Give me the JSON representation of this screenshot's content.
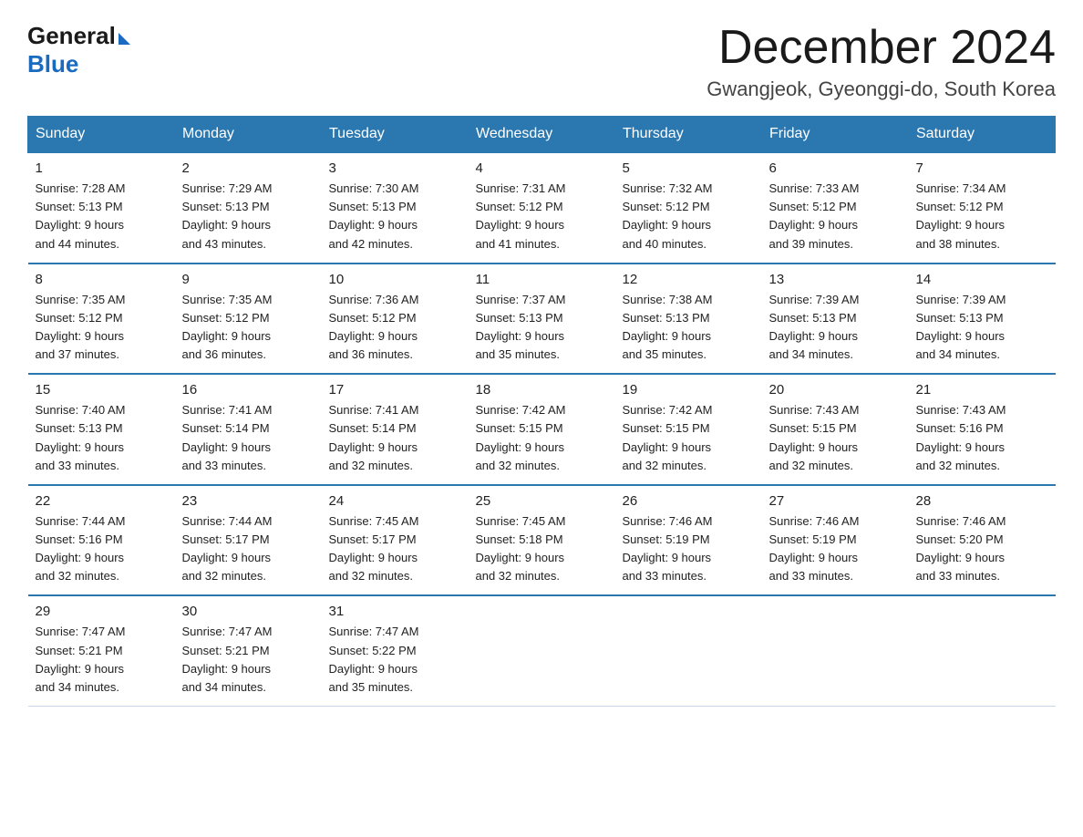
{
  "logo": {
    "general": "General",
    "blue": "Blue"
  },
  "title": "December 2024",
  "location": "Gwangjeok, Gyeonggi-do, South Korea",
  "headers": [
    "Sunday",
    "Monday",
    "Tuesday",
    "Wednesday",
    "Thursday",
    "Friday",
    "Saturday"
  ],
  "weeks": [
    [
      {
        "day": "1",
        "sunrise": "7:28 AM",
        "sunset": "5:13 PM",
        "daylight": "9 hours and 44 minutes."
      },
      {
        "day": "2",
        "sunrise": "7:29 AM",
        "sunset": "5:13 PM",
        "daylight": "9 hours and 43 minutes."
      },
      {
        "day": "3",
        "sunrise": "7:30 AM",
        "sunset": "5:13 PM",
        "daylight": "9 hours and 42 minutes."
      },
      {
        "day": "4",
        "sunrise": "7:31 AM",
        "sunset": "5:12 PM",
        "daylight": "9 hours and 41 minutes."
      },
      {
        "day": "5",
        "sunrise": "7:32 AM",
        "sunset": "5:12 PM",
        "daylight": "9 hours and 40 minutes."
      },
      {
        "day": "6",
        "sunrise": "7:33 AM",
        "sunset": "5:12 PM",
        "daylight": "9 hours and 39 minutes."
      },
      {
        "day": "7",
        "sunrise": "7:34 AM",
        "sunset": "5:12 PM",
        "daylight": "9 hours and 38 minutes."
      }
    ],
    [
      {
        "day": "8",
        "sunrise": "7:35 AM",
        "sunset": "5:12 PM",
        "daylight": "9 hours and 37 minutes."
      },
      {
        "day": "9",
        "sunrise": "7:35 AM",
        "sunset": "5:12 PM",
        "daylight": "9 hours and 36 minutes."
      },
      {
        "day": "10",
        "sunrise": "7:36 AM",
        "sunset": "5:12 PM",
        "daylight": "9 hours and 36 minutes."
      },
      {
        "day": "11",
        "sunrise": "7:37 AM",
        "sunset": "5:13 PM",
        "daylight": "9 hours and 35 minutes."
      },
      {
        "day": "12",
        "sunrise": "7:38 AM",
        "sunset": "5:13 PM",
        "daylight": "9 hours and 35 minutes."
      },
      {
        "day": "13",
        "sunrise": "7:39 AM",
        "sunset": "5:13 PM",
        "daylight": "9 hours and 34 minutes."
      },
      {
        "day": "14",
        "sunrise": "7:39 AM",
        "sunset": "5:13 PM",
        "daylight": "9 hours and 34 minutes."
      }
    ],
    [
      {
        "day": "15",
        "sunrise": "7:40 AM",
        "sunset": "5:13 PM",
        "daylight": "9 hours and 33 minutes."
      },
      {
        "day": "16",
        "sunrise": "7:41 AM",
        "sunset": "5:14 PM",
        "daylight": "9 hours and 33 minutes."
      },
      {
        "day": "17",
        "sunrise": "7:41 AM",
        "sunset": "5:14 PM",
        "daylight": "9 hours and 32 minutes."
      },
      {
        "day": "18",
        "sunrise": "7:42 AM",
        "sunset": "5:15 PM",
        "daylight": "9 hours and 32 minutes."
      },
      {
        "day": "19",
        "sunrise": "7:42 AM",
        "sunset": "5:15 PM",
        "daylight": "9 hours and 32 minutes."
      },
      {
        "day": "20",
        "sunrise": "7:43 AM",
        "sunset": "5:15 PM",
        "daylight": "9 hours and 32 minutes."
      },
      {
        "day": "21",
        "sunrise": "7:43 AM",
        "sunset": "5:16 PM",
        "daylight": "9 hours and 32 minutes."
      }
    ],
    [
      {
        "day": "22",
        "sunrise": "7:44 AM",
        "sunset": "5:16 PM",
        "daylight": "9 hours and 32 minutes."
      },
      {
        "day": "23",
        "sunrise": "7:44 AM",
        "sunset": "5:17 PM",
        "daylight": "9 hours and 32 minutes."
      },
      {
        "day": "24",
        "sunrise": "7:45 AM",
        "sunset": "5:17 PM",
        "daylight": "9 hours and 32 minutes."
      },
      {
        "day": "25",
        "sunrise": "7:45 AM",
        "sunset": "5:18 PM",
        "daylight": "9 hours and 32 minutes."
      },
      {
        "day": "26",
        "sunrise": "7:46 AM",
        "sunset": "5:19 PM",
        "daylight": "9 hours and 33 minutes."
      },
      {
        "day": "27",
        "sunrise": "7:46 AM",
        "sunset": "5:19 PM",
        "daylight": "9 hours and 33 minutes."
      },
      {
        "day": "28",
        "sunrise": "7:46 AM",
        "sunset": "5:20 PM",
        "daylight": "9 hours and 33 minutes."
      }
    ],
    [
      {
        "day": "29",
        "sunrise": "7:47 AM",
        "sunset": "5:21 PM",
        "daylight": "9 hours and 34 minutes."
      },
      {
        "day": "30",
        "sunrise": "7:47 AM",
        "sunset": "5:21 PM",
        "daylight": "9 hours and 34 minutes."
      },
      {
        "day": "31",
        "sunrise": "7:47 AM",
        "sunset": "5:22 PM",
        "daylight": "9 hours and 35 minutes."
      },
      null,
      null,
      null,
      null
    ]
  ]
}
